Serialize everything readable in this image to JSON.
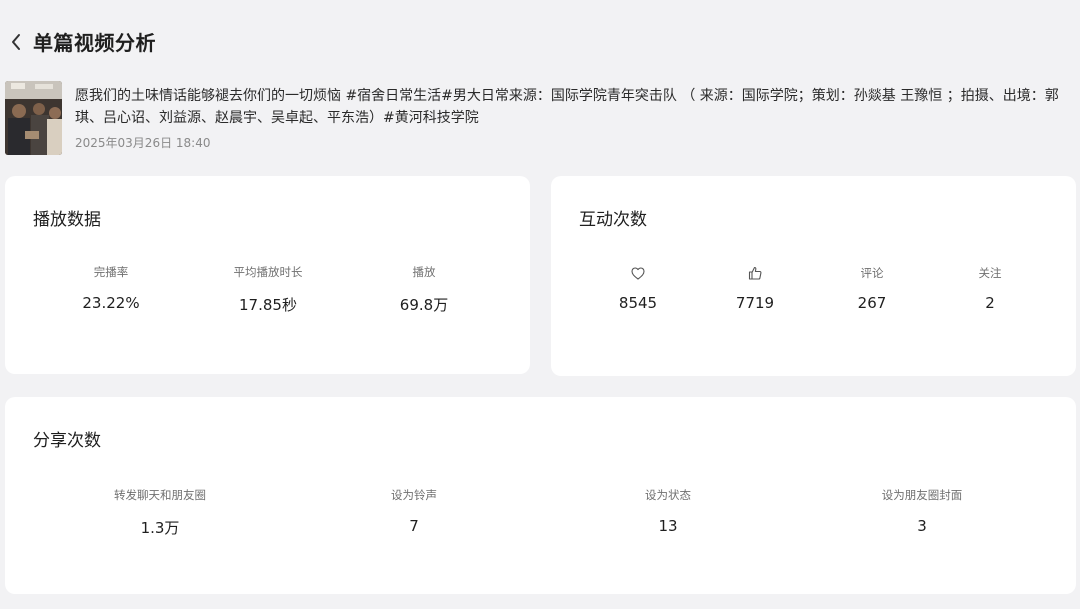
{
  "header": {
    "title": "单篇视频分析",
    "back_icon": "chevron-left-icon"
  },
  "video": {
    "description": "愿我们的土味情话能够褪去你们的一切烦恼 #宿舍日常生活#男大日常来源：国际学院青年突击队 （ 来源：国际学院；策划：孙燚基 王豫恒 ；拍摄、出境：郭琪、吕心诏、刘益源、赵晨宇、吴卓起、平东浩）#黄河科技学院",
    "date": "2025年03月26日 18:40"
  },
  "play_data": {
    "title": "播放数据",
    "metrics": [
      {
        "label": "完播率",
        "value": "23.22%"
      },
      {
        "label": "平均播放时长",
        "value": "17.85秒"
      },
      {
        "label": "播放",
        "value": "69.8万"
      }
    ]
  },
  "interaction": {
    "title": "互动次数",
    "metrics": [
      {
        "icon": "heart-icon",
        "value": "8545"
      },
      {
        "icon": "thumbs-up-icon",
        "value": "7719"
      },
      {
        "label": "评论",
        "value": "267"
      },
      {
        "label": "关注",
        "value": "2"
      }
    ]
  },
  "share": {
    "title": "分享次数",
    "metrics": [
      {
        "label": "转发聊天和朋友圈",
        "value": "1.3万"
      },
      {
        "label": "设为铃声",
        "value": "7"
      },
      {
        "label": "设为状态",
        "value": "13"
      },
      {
        "label": "设为朋友圈封面",
        "value": "3"
      }
    ]
  },
  "colors": {
    "background": "#f2f2f4",
    "card": "#ffffff",
    "text_primary": "#1f1f1f",
    "text_secondary": "#707070"
  }
}
